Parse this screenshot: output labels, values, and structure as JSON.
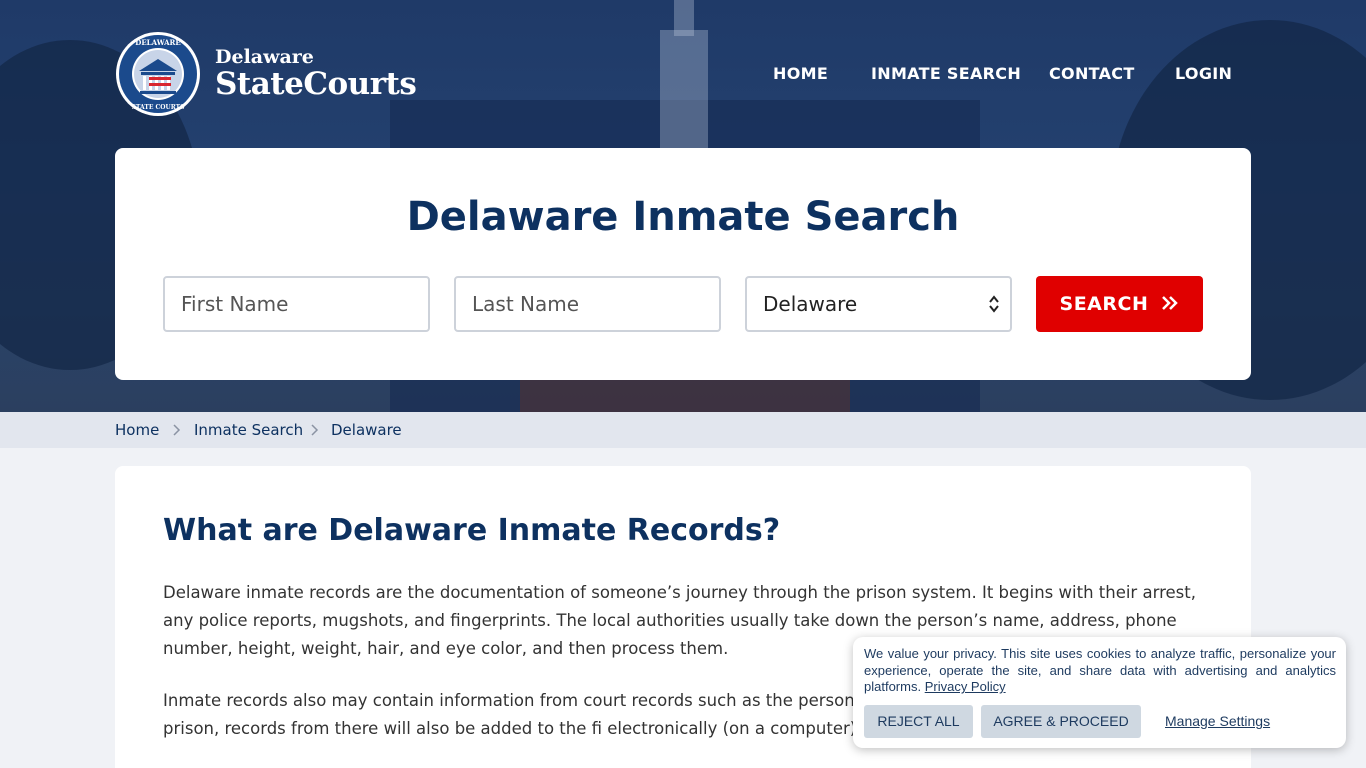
{
  "brand": {
    "small": "Delaware",
    "big": "StateCourts",
    "logo_text_top": "DELAWARE",
    "logo_text_bottom": "STATE COURTS"
  },
  "nav": [
    "HOME",
    "INMATE SEARCH",
    "CONTACT",
    "LOGIN"
  ],
  "search": {
    "title": "Delaware Inmate Search",
    "first_name_placeholder": "First Name",
    "last_name_placeholder": "Last Name",
    "state_selected": "Delaware",
    "button_label": "SEARCH",
    "button_icon": "double-chevron-right-icon"
  },
  "breadcrumb": [
    "Home",
    "Inmate Search",
    "Delaware"
  ],
  "content": {
    "title": "What are Delaware Inmate Records?",
    "p1": "Delaware inmate records are the documentation of someone’s journey through the prison system. It begins with their arrest, any police reports, mugshots, and fingerprints. The local authorities usually take down the person’s name, address, phone number, height, weight, hair, and eye color, and then process them.",
    "p2": "Inmate records also may contain information from court records such as the person’s cri parole. If they spend time in jail or prison, records from there will also be added to the fi electronically (on a computer) or in paper records."
  },
  "cookie": {
    "text": "We value your privacy. This site uses cookies to analyze traffic, personalize your experience, operate the site, and share data with advertising and analytics platforms.",
    "policy_link": "Privacy Policy",
    "reject": "REJECT ALL",
    "accept": "AGREE & PROCEED",
    "manage": "Manage Settings"
  },
  "colors": {
    "navy": "#0d3160",
    "hero": "#1f3a68",
    "search_button": "#e00000",
    "breadcrumb_bg": "#e2e6ee",
    "cookie_button": "#cfd8e1"
  }
}
